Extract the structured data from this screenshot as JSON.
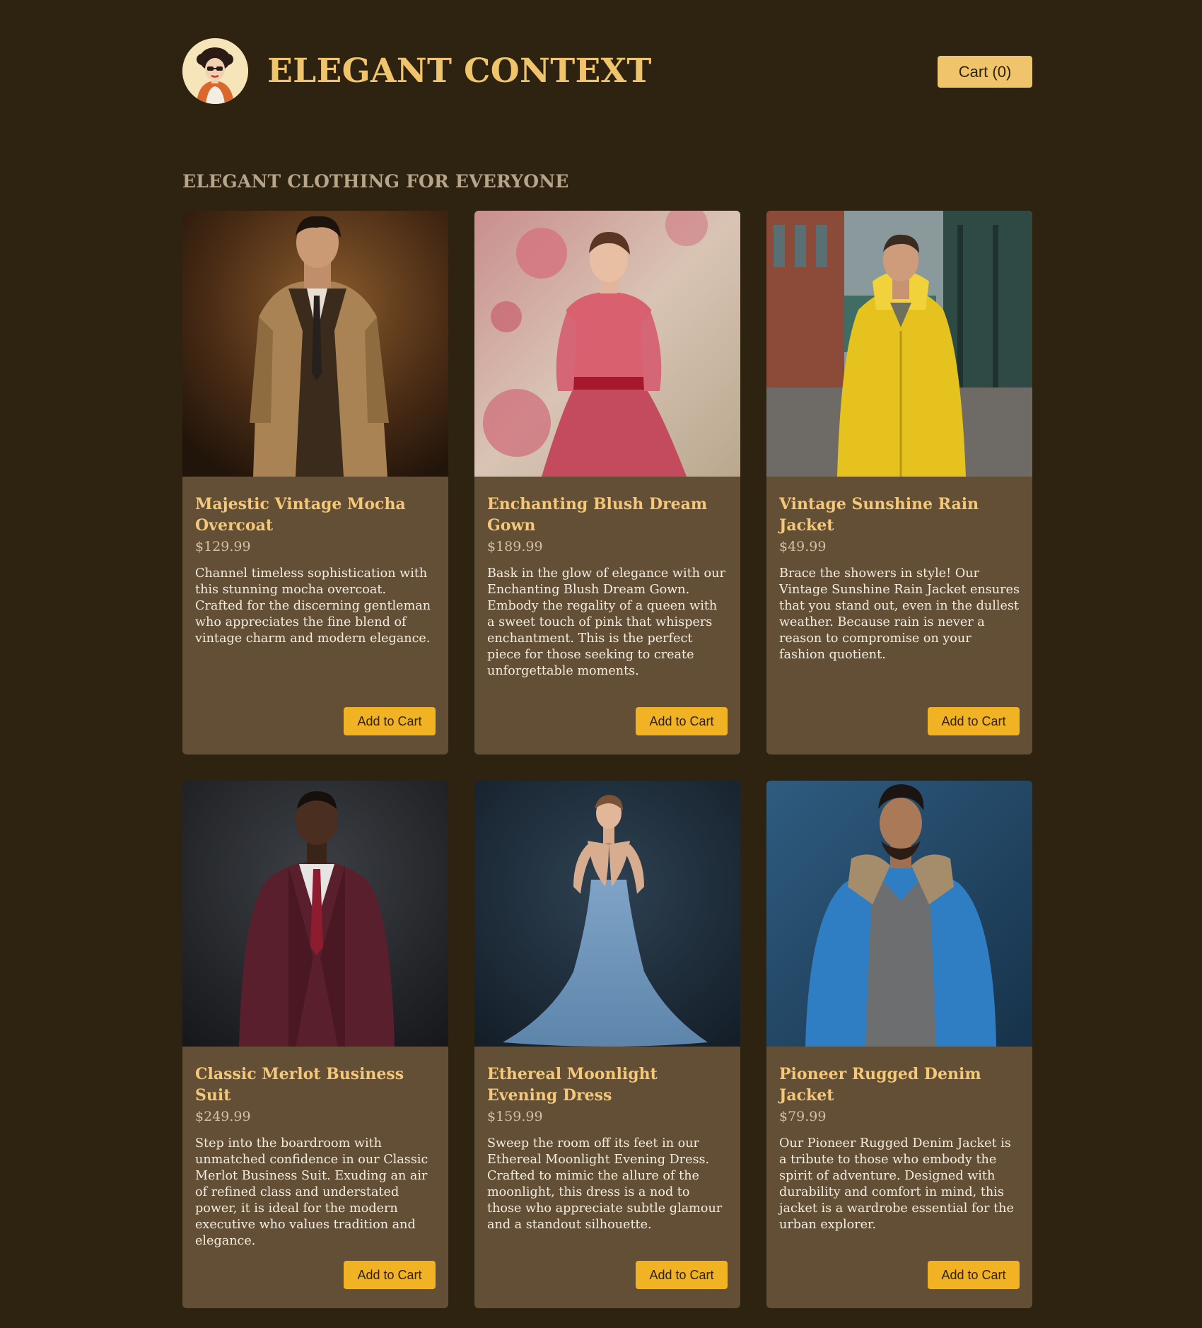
{
  "header": {
    "site_title": "ELEGANT CONTEXT",
    "cart_label": "Cart (0)"
  },
  "section": {
    "heading": "ELEGANT CLOTHING FOR EVERYONE"
  },
  "products": [
    {
      "title": "Majestic Vintage Mocha Overcoat",
      "price": "$129.99",
      "description": "Channel timeless sophistication with this stunning mocha overcoat. Crafted for the discerning gentleman who appreciates the fine blend of vintage charm and modern elegance.",
      "button_label": "Add to Cart",
      "image": "photo-man-mocha-overcoat"
    },
    {
      "title": "Enchanting Blush Dream Gown",
      "price": "$189.99",
      "description": "Bask in the glow of elegance with our Enchanting Blush Dream Gown. Embody the regality of a queen with a sweet touch of pink that whispers enchantment. This is the perfect piece for those seeking to create unforgettable moments.",
      "button_label": "Add to Cart",
      "image": "photo-woman-pink-gown"
    },
    {
      "title": "Vintage Sunshine Rain Jacket",
      "price": "$49.99",
      "description": "Brace the showers in style! Our Vintage Sunshine Rain Jacket ensures that you stand out, even in the dullest weather. Because rain is never a reason to compromise on your fashion quotient.",
      "button_label": "Add to Cart",
      "image": "photo-man-yellow-raincoat"
    },
    {
      "title": "Classic Merlot Business Suit",
      "price": "$249.99",
      "description": "Step into the boardroom with unmatched confidence in our Classic Merlot Business Suit. Exuding an air of refined class and understated power, it is ideal for the modern executive who values tradition and elegance.",
      "button_label": "Add to Cart",
      "image": "photo-man-merlot-suit"
    },
    {
      "title": "Ethereal Moonlight Evening Dress",
      "price": "$159.99",
      "description": "Sweep the room off its feet in our Ethereal Moonlight Evening Dress. Crafted to mimic the allure of the moonlight, this dress is a nod to those who appreciate subtle glamour and a standout silhouette.",
      "button_label": "Add to Cart",
      "image": "photo-woman-blue-dress"
    },
    {
      "title": "Pioneer Rugged Denim Jacket",
      "price": "$79.99",
      "description": "Our Pioneer Rugged Denim Jacket is a tribute to those who embody the spirit of adventure. Designed with durability and comfort in mind, this jacket is a wardrobe essential for the urban explorer.",
      "button_label": "Add to Cart",
      "image": "photo-man-denim-jacket"
    }
  ],
  "colors": {
    "page_background": "#2e2210",
    "card_background": "#624f35",
    "title_gold": "#f0c46a",
    "button_yellow": "#f1b324"
  }
}
